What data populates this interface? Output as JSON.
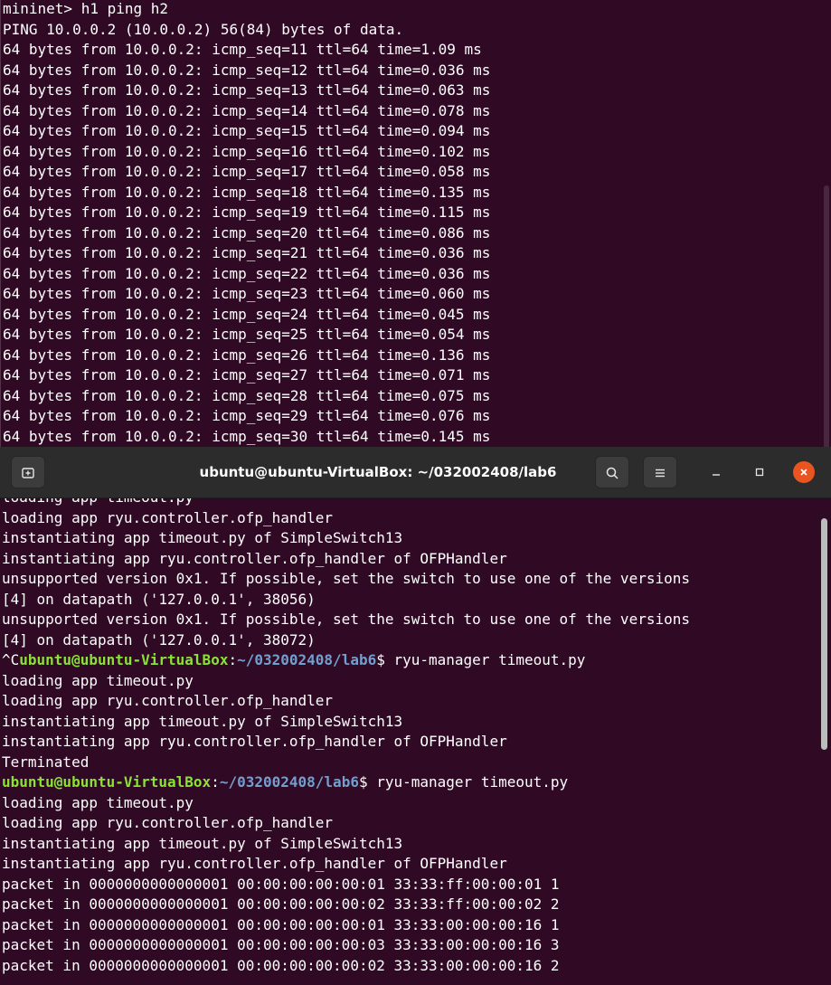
{
  "bg_terminal": {
    "lines": [
      "mininet> h1 ping h2",
      "PING 10.0.0.2 (10.0.0.2) 56(84) bytes of data.",
      "64 bytes from 10.0.0.2: icmp_seq=11 ttl=64 time=1.09 ms",
      "64 bytes from 10.0.0.2: icmp_seq=12 ttl=64 time=0.036 ms",
      "64 bytes from 10.0.0.2: icmp_seq=13 ttl=64 time=0.063 ms",
      "64 bytes from 10.0.0.2: icmp_seq=14 ttl=64 time=0.078 ms",
      "64 bytes from 10.0.0.2: icmp_seq=15 ttl=64 time=0.094 ms",
      "64 bytes from 10.0.0.2: icmp_seq=16 ttl=64 time=0.102 ms",
      "64 bytes from 10.0.0.2: icmp_seq=17 ttl=64 time=0.058 ms",
      "64 bytes from 10.0.0.2: icmp_seq=18 ttl=64 time=0.135 ms",
      "64 bytes from 10.0.0.2: icmp_seq=19 ttl=64 time=0.115 ms",
      "64 bytes from 10.0.0.2: icmp_seq=20 ttl=64 time=0.086 ms",
      "64 bytes from 10.0.0.2: icmp_seq=21 ttl=64 time=0.036 ms",
      "64 bytes from 10.0.0.2: icmp_seq=22 ttl=64 time=0.036 ms",
      "64 bytes from 10.0.0.2: icmp_seq=23 ttl=64 time=0.060 ms",
      "64 bytes from 10.0.0.2: icmp_seq=24 ttl=64 time=0.045 ms",
      "64 bytes from 10.0.0.2: icmp_seq=25 ttl=64 time=0.054 ms",
      "64 bytes from 10.0.0.2: icmp_seq=26 ttl=64 time=0.136 ms",
      "64 bytes from 10.0.0.2: icmp_seq=27 ttl=64 time=0.071 ms",
      "64 bytes from 10.0.0.2: icmp_seq=28 ttl=64 time=0.075 ms",
      "64 bytes from 10.0.0.2: icmp_seq=29 ttl=64 time=0.076 ms",
      "64 bytes from 10.0.0.2: icmp_seq=30 ttl=64 time=0.145 ms"
    ]
  },
  "fg_window": {
    "title": "ubuntu@ubuntu-VirtualBox: ~/032002408/lab6",
    "icons": {
      "new_tab": "new-tab-icon",
      "search": "search-icon",
      "menu": "hamburger-menu-icon",
      "minimize": "minimize-icon",
      "maximize": "maximize-icon",
      "close": "close-icon"
    },
    "prompt": {
      "user_host": "ubuntu@ubuntu-VirtualBox",
      "separator": ":",
      "path": "~/032002408/lab6",
      "dollar": "$ "
    },
    "lines": [
      {
        "type": "text",
        "text": "loading app timeout.py"
      },
      {
        "type": "text",
        "text": "loading app ryu.controller.ofp_handler"
      },
      {
        "type": "text",
        "text": "instantiating app timeout.py of SimpleSwitch13"
      },
      {
        "type": "text",
        "text": "instantiating app ryu.controller.ofp_handler of OFPHandler"
      },
      {
        "type": "text",
        "text": "unsupported version 0x1. If possible, set the switch to use one of the versions"
      },
      {
        "type": "text",
        "text": "[4] on datapath ('127.0.0.1', 38056)"
      },
      {
        "type": "text",
        "text": "unsupported version 0x1. If possible, set the switch to use one of the versions"
      },
      {
        "type": "text",
        "text": "[4] on datapath ('127.0.0.1', 38072)"
      },
      {
        "type": "prompt",
        "prefix": "^C",
        "command": "ryu-manager timeout.py"
      },
      {
        "type": "text",
        "text": "loading app timeout.py"
      },
      {
        "type": "text",
        "text": "loading app ryu.controller.ofp_handler"
      },
      {
        "type": "text",
        "text": "instantiating app timeout.py of SimpleSwitch13"
      },
      {
        "type": "text",
        "text": "instantiating app ryu.controller.ofp_handler of OFPHandler"
      },
      {
        "type": "text",
        "text": "Terminated"
      },
      {
        "type": "prompt",
        "prefix": "",
        "command": "ryu-manager timeout.py"
      },
      {
        "type": "text",
        "text": "loading app timeout.py"
      },
      {
        "type": "text",
        "text": "loading app ryu.controller.ofp_handler"
      },
      {
        "type": "text",
        "text": "instantiating app timeout.py of SimpleSwitch13"
      },
      {
        "type": "text",
        "text": "instantiating app ryu.controller.ofp_handler of OFPHandler"
      },
      {
        "type": "text",
        "text": "packet in 0000000000000001 00:00:00:00:00:01 33:33:ff:00:00:01 1"
      },
      {
        "type": "text",
        "text": "packet in 0000000000000001 00:00:00:00:00:02 33:33:ff:00:00:02 2"
      },
      {
        "type": "text",
        "text": "packet in 0000000000000001 00:00:00:00:00:01 33:33:00:00:00:16 1"
      },
      {
        "type": "text",
        "text": "packet in 0000000000000001 00:00:00:00:00:03 33:33:00:00:00:16 3"
      },
      {
        "type": "text",
        "text": "packet in 0000000000000001 00:00:00:00:00:02 33:33:00:00:00:16 2"
      }
    ]
  }
}
